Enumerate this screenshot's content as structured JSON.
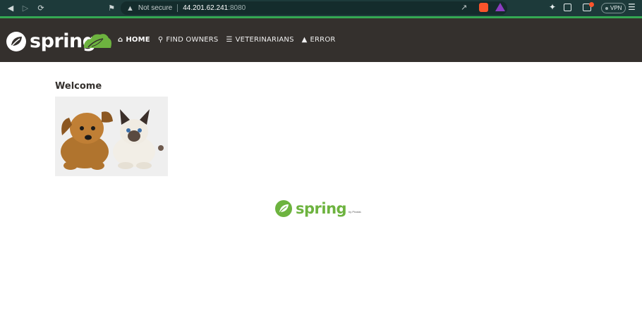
{
  "browser": {
    "security_label": "Not secure",
    "url_host": "44.201.62.241",
    "url_port": ":8080",
    "vpn_label": "VPN"
  },
  "app": {
    "brand": "spring",
    "nav": [
      {
        "label": "HOME",
        "icon": "home-icon"
      },
      {
        "label": "FIND OWNERS",
        "icon": "search-icon"
      },
      {
        "label": "VETERINARIANS",
        "icon": "list-icon"
      },
      {
        "label": "ERROR",
        "icon": "warning-icon"
      }
    ]
  },
  "main": {
    "heading": "Welcome"
  },
  "footer": {
    "brand": "spring",
    "by": "by Pivotal."
  },
  "colors": {
    "navbar_bg": "#34302d",
    "spring_green": "#6db33f",
    "browser_chrome": "#1d3a3a"
  }
}
